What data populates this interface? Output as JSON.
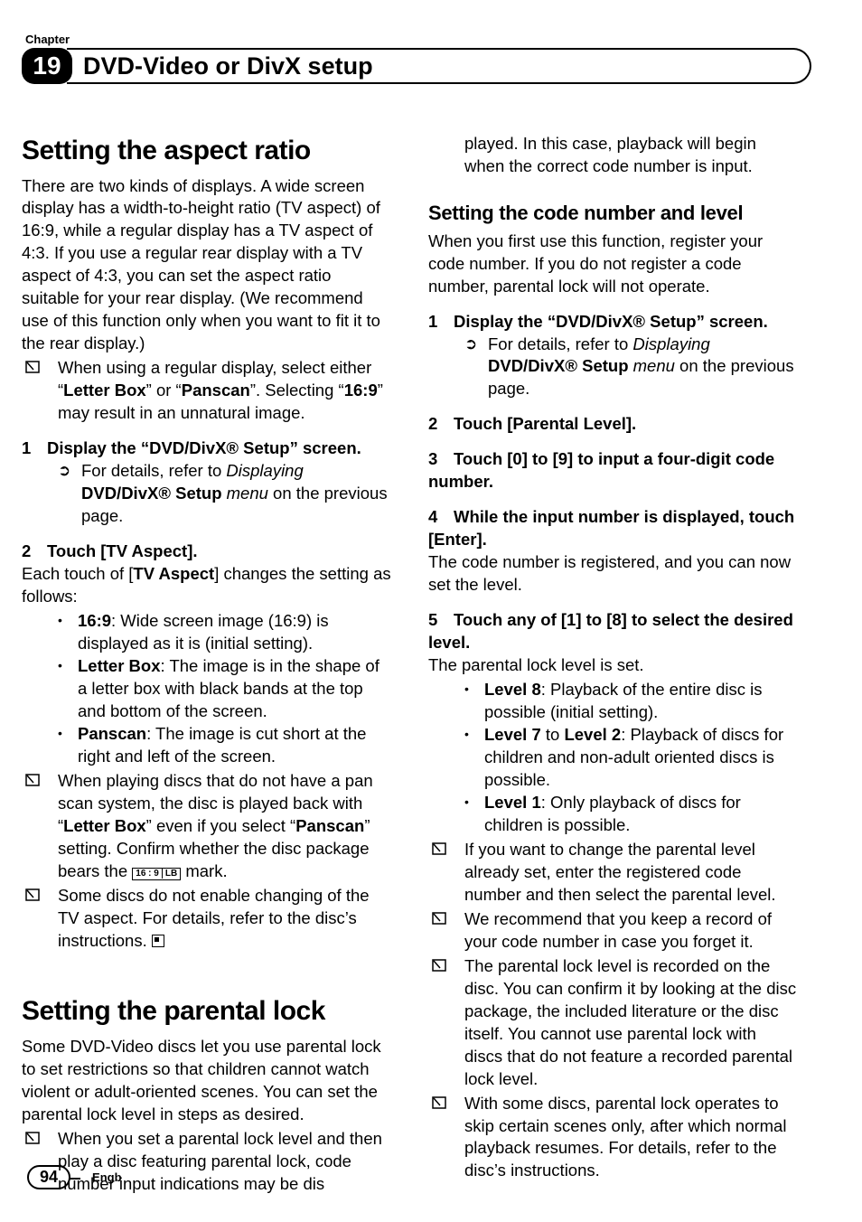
{
  "header": {
    "chapter_label": "Chapter",
    "chapter_number": "19",
    "title": "DVD-Video or DivX setup"
  },
  "left": {
    "sec1_title": "Setting the aspect ratio",
    "sec1_intro": "There are two kinds of displays. A wide screen display has a width-to-height ratio (TV aspect) of 16:9, while a regular display has a TV aspect of 4:3. If you use a regular rear display with a TV aspect of 4:3, you can set the aspect ratio suitable for your rear display. (We recommend use of this function only when you want to fit it to the rear display.)",
    "sec1_note1_a": "When using a regular display, select either “",
    "sec1_note1_b": "Letter Box",
    "sec1_note1_c": "” or “",
    "sec1_note1_d": "Panscan",
    "sec1_note1_e": "”. Selecting “",
    "sec1_note1_f": "16:9",
    "sec1_note1_g": "” may result in an unnatural image.",
    "sec1_step1": "Display the “DVD/DivX® Setup” screen.",
    "sec1_step1_ref_a": "For details, refer to ",
    "sec1_step1_ref_b": "Displaying ",
    "sec1_step1_ref_c": "DVD/DivX® Setup",
    "sec1_step1_ref_d": " menu",
    "sec1_step1_ref_e": " on the previous page.",
    "sec1_step2": "Touch [TV Aspect].",
    "sec1_step2_desc_a": "Each touch of [",
    "sec1_step2_desc_b": "TV Aspect",
    "sec1_step2_desc_c": "] changes the setting as follows:",
    "sec1_b1_a": "16:9",
    "sec1_b1_b": ": Wide screen image (16:9) is displayed as it is (initial setting).",
    "sec1_b2_a": "Letter Box",
    "sec1_b2_b": ": The image is in the shape of a letter box with black bands at the top and bottom of the screen.",
    "sec1_b3_a": "Panscan",
    "sec1_b3_b": ": The image is cut short at the right and left of the screen.",
    "sec1_note2_a": "When playing discs that do not have a pan scan system, the disc is played back with “",
    "sec1_note2_b": "Letter Box",
    "sec1_note2_c": "” even if you select “",
    "sec1_note2_d": "Panscan",
    "sec1_note2_e": "” setting. Confirm whether the disc package bears the ",
    "sec1_note2_mark1": "16 : 9",
    "sec1_note2_mark2": "LB",
    "sec1_note2_f": " mark.",
    "sec1_note3": "Some discs do not enable changing of the TV aspect. For details, refer to the disc’s instructions.",
    "sec2_title": "Setting the parental lock",
    "sec2_intro": "Some DVD-Video discs let you use parental lock to set restrictions so that children cannot watch violent or adult-oriented scenes. You can set the parental lock level in steps as desired.",
    "sec2_note1": "When you set a parental lock level and then play a disc featuring parental lock, code number input indications may be dis"
  },
  "right": {
    "cont": "played. In this case, playback will begin when the correct code number is input.",
    "sub_title": "Setting the code number and level",
    "sub_intro": "When you first use this function, register your code number. If you do not register a code number, parental lock will not operate.",
    "step1": "Display the “DVD/DivX® Setup” screen.",
    "step1_ref_a": "For details, refer to ",
    "step1_ref_b": "Displaying ",
    "step1_ref_c": "DVD/DivX® Setup",
    "step1_ref_d": " menu",
    "step1_ref_e": " on the previous page.",
    "step2": "Touch [Parental Level].",
    "step3": "Touch [0] to [9] to input a four-digit code number.",
    "step4": "While the input number is displayed, touch [Enter].",
    "step4_desc": "The code number is registered, and you can now set the level.",
    "step5": "Touch any of [1] to [8] to select the desired level.",
    "step5_desc": "The parental lock level is set.",
    "b1_a": "Level 8",
    "b1_b": ": Playback of the entire disc is possible (initial setting).",
    "b2_a": "Level 7",
    "b2_b": " to ",
    "b2_c": "Level 2",
    "b2_d": ": Playback of discs for children and non-adult oriented discs is possible.",
    "b3_a": "Level 1",
    "b3_b": ": Only playback of discs for children is possible.",
    "n1": "If you want to change the parental level already set, enter the registered code number and then select the parental level.",
    "n2": "We recommend that you keep a record of your code number in case you forget it.",
    "n3": "The parental lock level is recorded on the disc. You can confirm it by looking at the disc package, the included literature or the disc itself. You cannot use parental lock with discs that do not feature a recorded parental lock level.",
    "n4": "With some discs, parental lock operates to skip certain scenes only, after which normal playback resumes. For details, refer to the disc’s instructions."
  },
  "footer": {
    "page": "94",
    "lang": "Engb"
  },
  "labels": {
    "n1": "1",
    "n2": "2",
    "n3": "3",
    "n4": "4",
    "n5": "5"
  }
}
